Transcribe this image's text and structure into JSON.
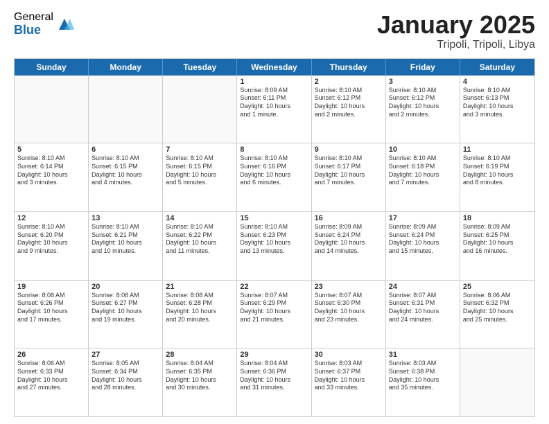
{
  "logo": {
    "general": "General",
    "blue": "Blue"
  },
  "title": {
    "month": "January 2025",
    "location": "Tripoli, Tripoli, Libya"
  },
  "weekdays": [
    "Sunday",
    "Monday",
    "Tuesday",
    "Wednesday",
    "Thursday",
    "Friday",
    "Saturday"
  ],
  "rows": [
    [
      {
        "day": "",
        "info": ""
      },
      {
        "day": "",
        "info": ""
      },
      {
        "day": "",
        "info": ""
      },
      {
        "day": "1",
        "info": "Sunrise: 8:09 AM\nSunset: 6:11 PM\nDaylight: 10 hours\nand 1 minute."
      },
      {
        "day": "2",
        "info": "Sunrise: 8:10 AM\nSunset: 6:12 PM\nDaylight: 10 hours\nand 2 minutes."
      },
      {
        "day": "3",
        "info": "Sunrise: 8:10 AM\nSunset: 6:12 PM\nDaylight: 10 hours\nand 2 minutes."
      },
      {
        "day": "4",
        "info": "Sunrise: 8:10 AM\nSunset: 6:13 PM\nDaylight: 10 hours\nand 3 minutes."
      }
    ],
    [
      {
        "day": "5",
        "info": "Sunrise: 8:10 AM\nSunset: 6:14 PM\nDaylight: 10 hours\nand 3 minutes."
      },
      {
        "day": "6",
        "info": "Sunrise: 8:10 AM\nSunset: 6:15 PM\nDaylight: 10 hours\nand 4 minutes."
      },
      {
        "day": "7",
        "info": "Sunrise: 8:10 AM\nSunset: 6:15 PM\nDaylight: 10 hours\nand 5 minutes."
      },
      {
        "day": "8",
        "info": "Sunrise: 8:10 AM\nSunset: 6:16 PM\nDaylight: 10 hours\nand 6 minutes."
      },
      {
        "day": "9",
        "info": "Sunrise: 8:10 AM\nSunset: 6:17 PM\nDaylight: 10 hours\nand 7 minutes."
      },
      {
        "day": "10",
        "info": "Sunrise: 8:10 AM\nSunset: 6:18 PM\nDaylight: 10 hours\nand 7 minutes."
      },
      {
        "day": "11",
        "info": "Sunrise: 8:10 AM\nSunset: 6:19 PM\nDaylight: 10 hours\nand 8 minutes."
      }
    ],
    [
      {
        "day": "12",
        "info": "Sunrise: 8:10 AM\nSunset: 6:20 PM\nDaylight: 10 hours\nand 9 minutes."
      },
      {
        "day": "13",
        "info": "Sunrise: 8:10 AM\nSunset: 6:21 PM\nDaylight: 10 hours\nand 10 minutes."
      },
      {
        "day": "14",
        "info": "Sunrise: 8:10 AM\nSunset: 6:22 PM\nDaylight: 10 hours\nand 11 minutes."
      },
      {
        "day": "15",
        "info": "Sunrise: 8:10 AM\nSunset: 6:23 PM\nDaylight: 10 hours\nand 13 minutes."
      },
      {
        "day": "16",
        "info": "Sunrise: 8:09 AM\nSunset: 6:24 PM\nDaylight: 10 hours\nand 14 minutes."
      },
      {
        "day": "17",
        "info": "Sunrise: 8:09 AM\nSunset: 6:24 PM\nDaylight: 10 hours\nand 15 minutes."
      },
      {
        "day": "18",
        "info": "Sunrise: 8:09 AM\nSunset: 6:25 PM\nDaylight: 10 hours\nand 16 minutes."
      }
    ],
    [
      {
        "day": "19",
        "info": "Sunrise: 8:08 AM\nSunset: 6:26 PM\nDaylight: 10 hours\nand 17 minutes."
      },
      {
        "day": "20",
        "info": "Sunrise: 8:08 AM\nSunset: 6:27 PM\nDaylight: 10 hours\nand 19 minutes."
      },
      {
        "day": "21",
        "info": "Sunrise: 8:08 AM\nSunset: 6:28 PM\nDaylight: 10 hours\nand 20 minutes."
      },
      {
        "day": "22",
        "info": "Sunrise: 8:07 AM\nSunset: 6:29 PM\nDaylight: 10 hours\nand 21 minutes."
      },
      {
        "day": "23",
        "info": "Sunrise: 8:07 AM\nSunset: 6:30 PM\nDaylight: 10 hours\nand 23 minutes."
      },
      {
        "day": "24",
        "info": "Sunrise: 8:07 AM\nSunset: 6:31 PM\nDaylight: 10 hours\nand 24 minutes."
      },
      {
        "day": "25",
        "info": "Sunrise: 8:06 AM\nSunset: 6:32 PM\nDaylight: 10 hours\nand 25 minutes."
      }
    ],
    [
      {
        "day": "26",
        "info": "Sunrise: 8:06 AM\nSunset: 6:33 PM\nDaylight: 10 hours\nand 27 minutes."
      },
      {
        "day": "27",
        "info": "Sunrise: 8:05 AM\nSunset: 6:34 PM\nDaylight: 10 hours\nand 28 minutes."
      },
      {
        "day": "28",
        "info": "Sunrise: 8:04 AM\nSunset: 6:35 PM\nDaylight: 10 hours\nand 30 minutes."
      },
      {
        "day": "29",
        "info": "Sunrise: 8:04 AM\nSunset: 6:36 PM\nDaylight: 10 hours\nand 31 minutes."
      },
      {
        "day": "30",
        "info": "Sunrise: 8:03 AM\nSunset: 6:37 PM\nDaylight: 10 hours\nand 33 minutes."
      },
      {
        "day": "31",
        "info": "Sunrise: 8:03 AM\nSunset: 6:38 PM\nDaylight: 10 hours\nand 35 minutes."
      },
      {
        "day": "",
        "info": ""
      }
    ]
  ]
}
